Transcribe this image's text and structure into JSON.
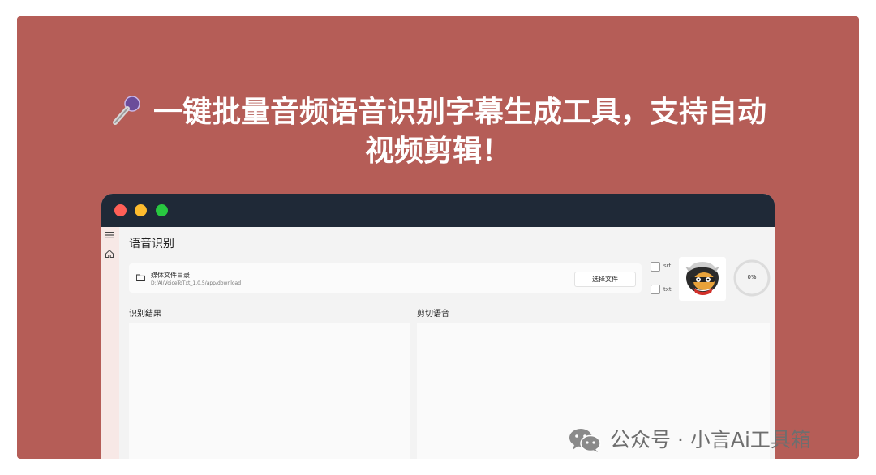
{
  "headline": {
    "line1": "一键批量音频语音识别字幕生成工具，支持自动",
    "line2": "视频剪辑！",
    "icon": "microphone-icon"
  },
  "app": {
    "page_title": "语音识别",
    "file_picker": {
      "label": "媒体文件目录",
      "path": "D:/AI/VoiceToTxt_1.0.5/app/download",
      "button": "选择文件"
    },
    "options": {
      "srt_label": "srt",
      "txt_label": "txt",
      "srt_checked": false,
      "txt_checked": false
    },
    "progress": {
      "text": "0%",
      "value": 0
    },
    "sections": {
      "result_label": "识别结果",
      "cut_label": "剪切语音"
    }
  },
  "watermark": {
    "text": "公众号 · 小言Ai工具箱"
  },
  "colors": {
    "banner": "#b55d57",
    "titlebar": "#1f2937",
    "traffic_red": "#ff5f57",
    "traffic_yellow": "#febc2e",
    "traffic_green": "#28c840"
  }
}
